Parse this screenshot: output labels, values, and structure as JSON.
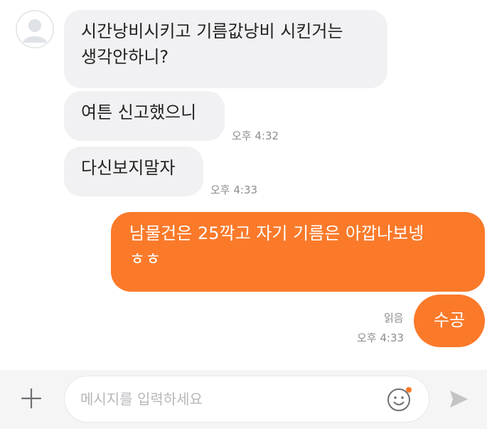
{
  "messages": {
    "m1_line1": "시간낭비시키고 기름값낭비 시킨거는",
    "m1_line2": "생각안하니?",
    "m2": "여튼 신고했으니",
    "m2_time": "오후 4:32",
    "m3": "다신보지말자",
    "m3_time": "오후 4:33",
    "m4_line1": "남물건은 25깍고 자기 기름은 아깝나보넹",
    "m4_line2": "ㅎㅎ",
    "m5": "수공",
    "m5_read": "읽음",
    "m5_time": "오후 4:33"
  },
  "input": {
    "placeholder": "메시지를 입력하세요"
  },
  "icons": {
    "avatar": "default-avatar-icon",
    "plus": "plus-icon",
    "emoji": "emoji-icon",
    "send": "send-icon"
  },
  "colors": {
    "outgoing_bubble": "#fb7a2a",
    "incoming_bubble": "#f1f1f3",
    "notification_dot": "#fb7a2a"
  }
}
